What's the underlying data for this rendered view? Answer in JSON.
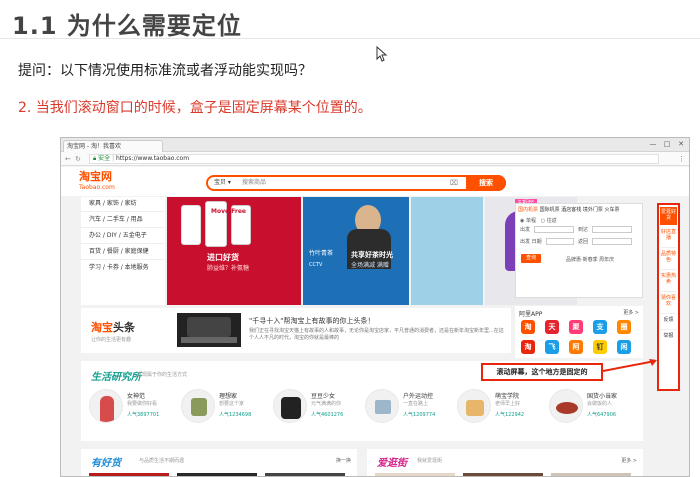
{
  "slide": {
    "title": "1.1 为什么需要定位",
    "question": "提问：以下情况使用标准流或者浮动能实现吗？",
    "point2": "2. 当我们滚动窗口的时候，盒子是固定屏幕某个位置的。"
  },
  "browser": {
    "tab_title": "淘宝网 - 淘！我喜欢",
    "url_secure": "安全",
    "url": "https://www.taobao.com",
    "win_buttons": [
      "—",
      "□",
      "✕"
    ]
  },
  "taobao": {
    "logo": "淘宝网",
    "logo_sub": "Taobao.com",
    "search": {
      "select": "宝贝",
      "placeholder": "搜索商品",
      "button": "搜索"
    },
    "categories": [
      "家具 / 家饰 / 家纺",
      "汽车 / 二手车 / 用品",
      "办公 / DIY / 五金电子",
      "百货 / 餐厨 / 家庭保健",
      "学习 / 卡券 / 本地服务"
    ],
    "banner1": {
      "brand": "Move Free",
      "line1": "进口好货",
      "line2": "肺益维？补氨糖"
    },
    "banner2": {
      "line1": "共享好茶时光",
      "line2": "全场满减 满赠"
    },
    "banner3": {
      "tag": "竹叶青茶",
      "sub": "CCTV"
    },
    "banner4": {
      "tag": "5折起"
    },
    "right_panel": {
      "tabs": [
        "国内机票",
        "国际机票",
        "酒店客栈",
        "境外门票",
        "火车票"
      ],
      "trip_one": "单程",
      "trip_round": "往返",
      "from": "出发",
      "to": "到达",
      "date": "出发 日期",
      "return": "返回",
      "search_btn": "查询",
      "link1": "品牌惠·新春季 周年庆"
    },
    "app_panel": {
      "title": "阿里APP",
      "more": "更多 >",
      "icons": [
        {
          "label": "淘",
          "color": "#ff5000"
        },
        {
          "label": "天",
          "color": "#e3262e"
        },
        {
          "label": "聚",
          "color": "#ff3c73"
        },
        {
          "label": "支",
          "color": "#1a9ee8"
        },
        {
          "label": "圈",
          "color": "#ff8800"
        },
        {
          "label": "淘",
          "color": "#e8260c"
        },
        {
          "label": "飞",
          "color": "#1a9ee8"
        },
        {
          "label": "阿",
          "color": "#ff7a00"
        },
        {
          "label": "钉",
          "color": "#ffcc00"
        },
        {
          "label": "闲",
          "color": "#1a9ee8"
        }
      ]
    },
    "headline": {
      "logo_tb": "淘宝",
      "logo_tt": "头条",
      "sub": "让你的生活更有趣",
      "title": "\"千寻十入\"帮淘宝上有故事的你上头条！",
      "body": "我们正在寻找淘宝天猫上有故事的人和故事，无论你是淘宝店家，平凡普通的消费者，还是在新年淘宝新年里...在这个人人不凡的时代，淘宝的你就是最棒的"
    },
    "life": {
      "title": "生活研究所",
      "sub": "发现属于你的生活方式",
      "items": [
        {
          "name": "女神范",
          "desc": "我要做你好看",
          "pop": "人气3897701"
        },
        {
          "name": "理想家",
          "desc": "想要这个家",
          "pop": "人气1234698"
        },
        {
          "name": "豆豆少女",
          "desc": "元气满满的你",
          "pop": "人气4601276"
        },
        {
          "name": "户外运动控",
          "desc": "一直在路上",
          "pop": "人气1209774"
        },
        {
          "name": "萌宝学院",
          "desc": "老师早上好",
          "pop": "人气122942"
        },
        {
          "name": "国货小当家",
          "desc": "会做饭的人",
          "pop": "人气647906"
        }
      ]
    },
    "good": {
      "title": "有好货",
      "sub": "与品质生活不期而遇",
      "more": "换一换"
    },
    "street": {
      "title": "爱逛街",
      "sub": "我就爱逛街",
      "more": "更多 >"
    },
    "fixed_nav": [
      "爱逛好货",
      "好店直播",
      "品质特色",
      "实惠热卖",
      "猜你喜欢",
      "反馈",
      "举报"
    ],
    "callout": "滚动屏幕，这个地方是固定的"
  }
}
